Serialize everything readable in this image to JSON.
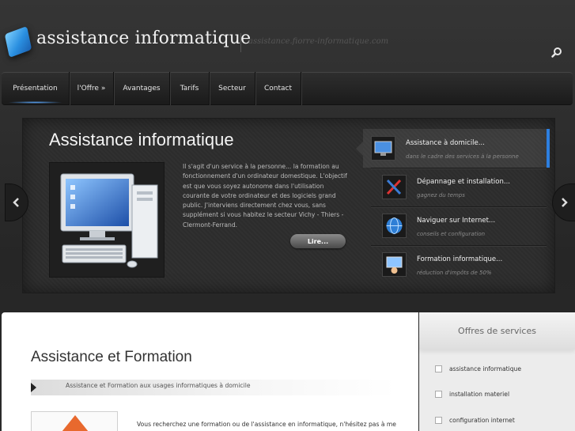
{
  "header": {
    "logo_text": "assistance informatique",
    "tagline": "assistance.fiorre-informatique.com"
  },
  "nav": {
    "items": [
      {
        "label": "Présentation"
      },
      {
        "label": "l'Offre »"
      },
      {
        "label": "Avantages"
      },
      {
        "label": "Tarifs"
      },
      {
        "label": "Secteur"
      },
      {
        "label": "Contact"
      }
    ]
  },
  "slider": {
    "title": "Assistance informatique",
    "text": "Il s'agit d'un service à la personne... la formation au fonctionnement d'un ordinateur domestique. L'objectif est que vous soyez autonome dans l'utilisation courante de votre ordinateur et des logiciels grand public. J'interviens directement chez vous, sans supplément si vous habitez le secteur Vichy - Thiers - Clermont-Ferrand.",
    "read_more": "Lire...",
    "tabs": [
      {
        "title": "Assistance à domicile...",
        "subtitle": "dans le cadre des services à la personne"
      },
      {
        "title": "Dépannage et installation...",
        "subtitle": "gagnez du temps"
      },
      {
        "title": "Naviguer sur Internet...",
        "subtitle": "conseils et configuration"
      },
      {
        "title": "Formation informatique...",
        "subtitle": "réduction d'impôts de 50%"
      }
    ]
  },
  "content": {
    "title": "Assistance et Formation",
    "ribbon": "Assistance et Formation aux usages informatiques à domicile",
    "intro": "Vous recherchez une formation ou de l'assistance en informatique, n'hésitez pas à me"
  },
  "sidebar": {
    "heading": "Offres de services",
    "items": [
      {
        "label": "assistance informatique"
      },
      {
        "label": "installation materiel"
      },
      {
        "label": "configuration internet"
      }
    ]
  },
  "colors": {
    "accent": "#2d7fe0",
    "background": "#2b2b2b",
    "panel": "#ffffff"
  }
}
